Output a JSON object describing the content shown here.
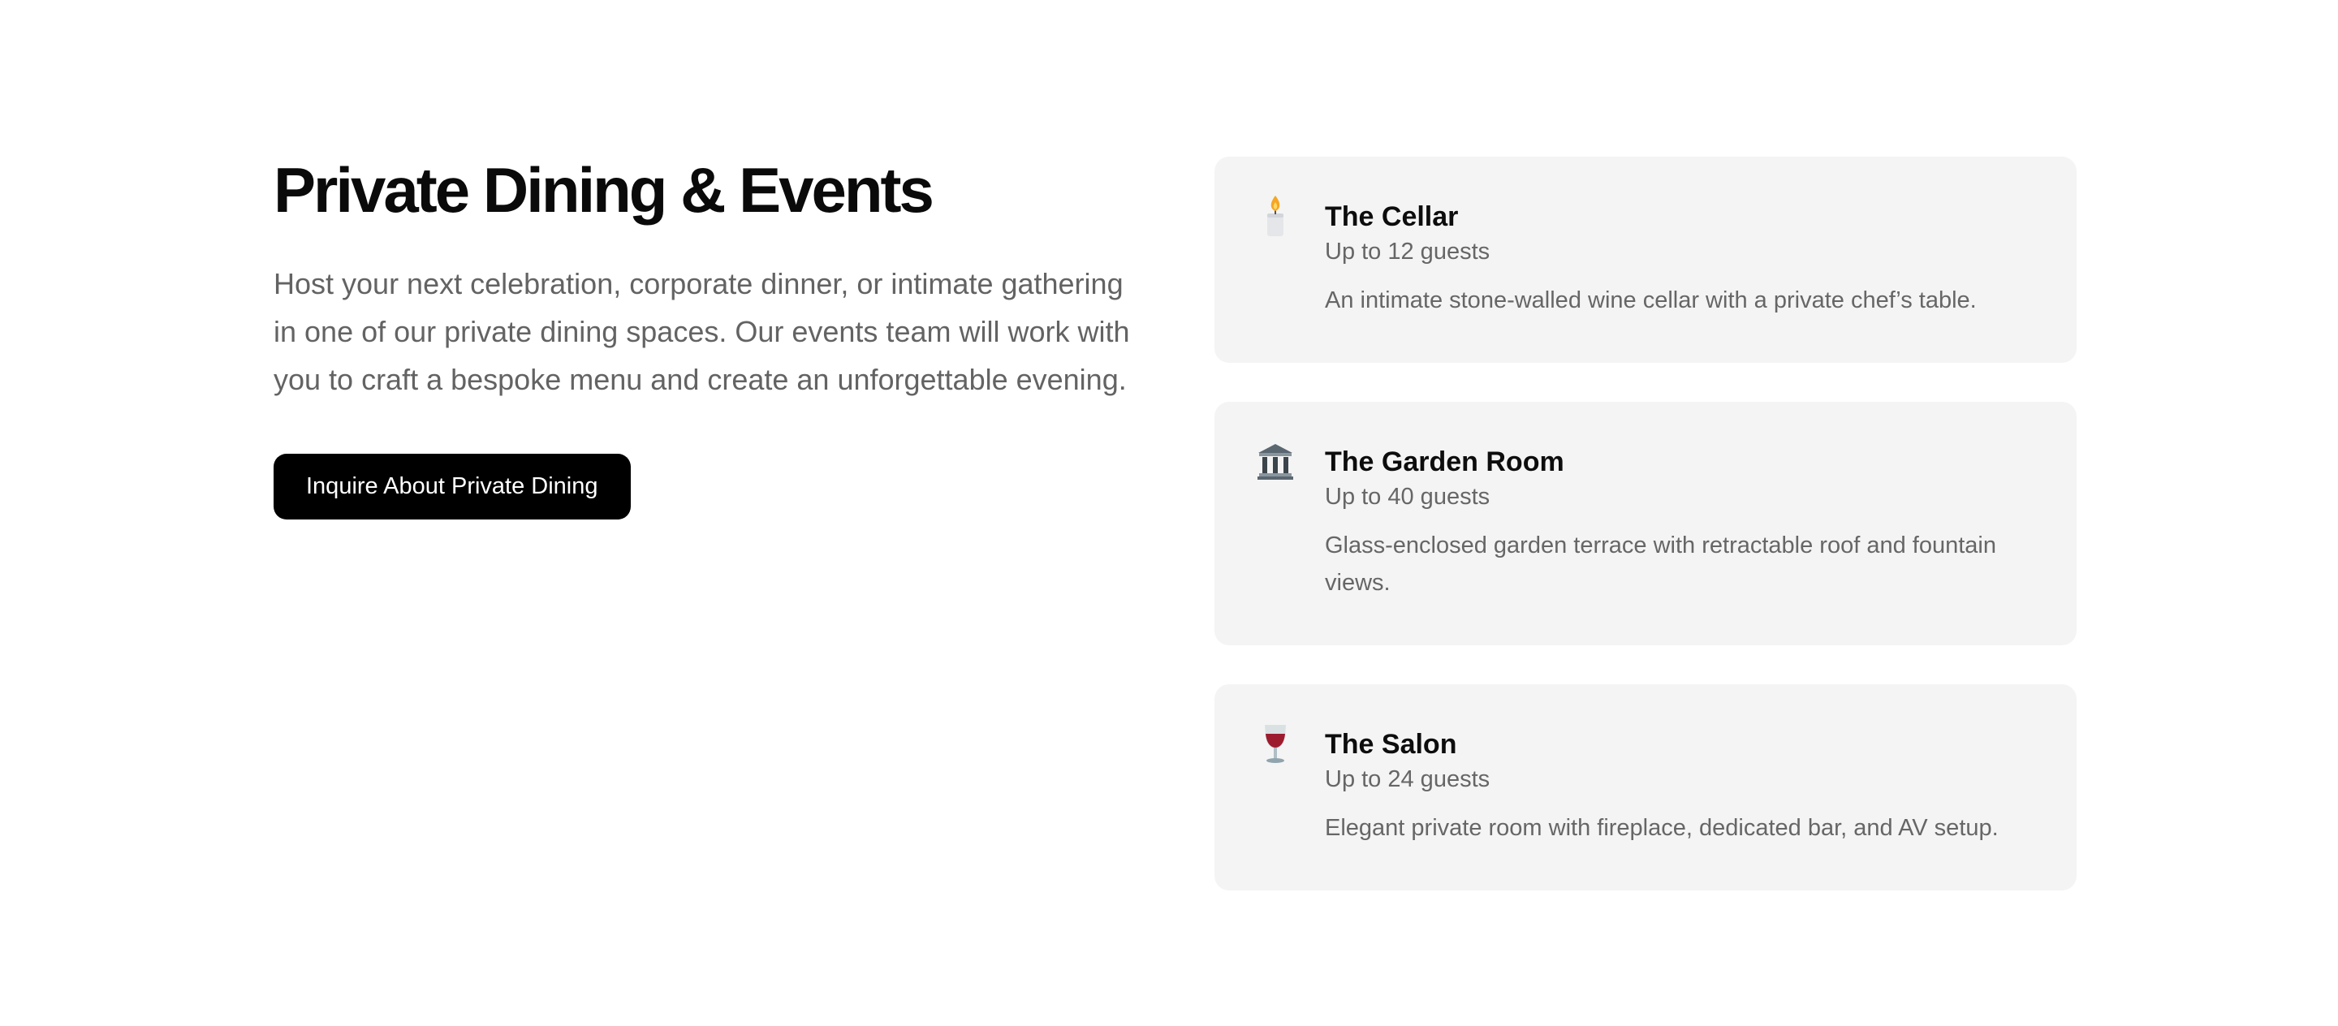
{
  "section": {
    "title": "Private Dining & Events",
    "intro": "Host your next celebration, corporate dinner, or intimate gathering in one of our private dining spaces. Our events team will work with you to craft a bespoke menu and create an unforgettable evening.",
    "cta_label": "Inquire About Private Dining"
  },
  "rooms": [
    {
      "icon": "candle-icon",
      "name": "The Cellar",
      "capacity": "Up to 12 guests",
      "description": "An intimate stone-walled wine cellar with a private chef’s table."
    },
    {
      "icon": "classical-building-icon",
      "name": "The Garden Room",
      "capacity": "Up to 40 guests",
      "description": "Glass-enclosed garden terrace with retractable roof and fountain views."
    },
    {
      "icon": "wine-glass-icon",
      "name": "The Salon",
      "capacity": "Up to 24 guests",
      "description": "Elegant private room with fireplace, dedicated bar, and AV setup."
    }
  ],
  "colors": {
    "background": "#ffffff",
    "card_background": "#f4f4f4",
    "cta_background": "#000000",
    "cta_text": "#ffffff",
    "heading": "#0a0a0a",
    "body_text": "#636363"
  }
}
